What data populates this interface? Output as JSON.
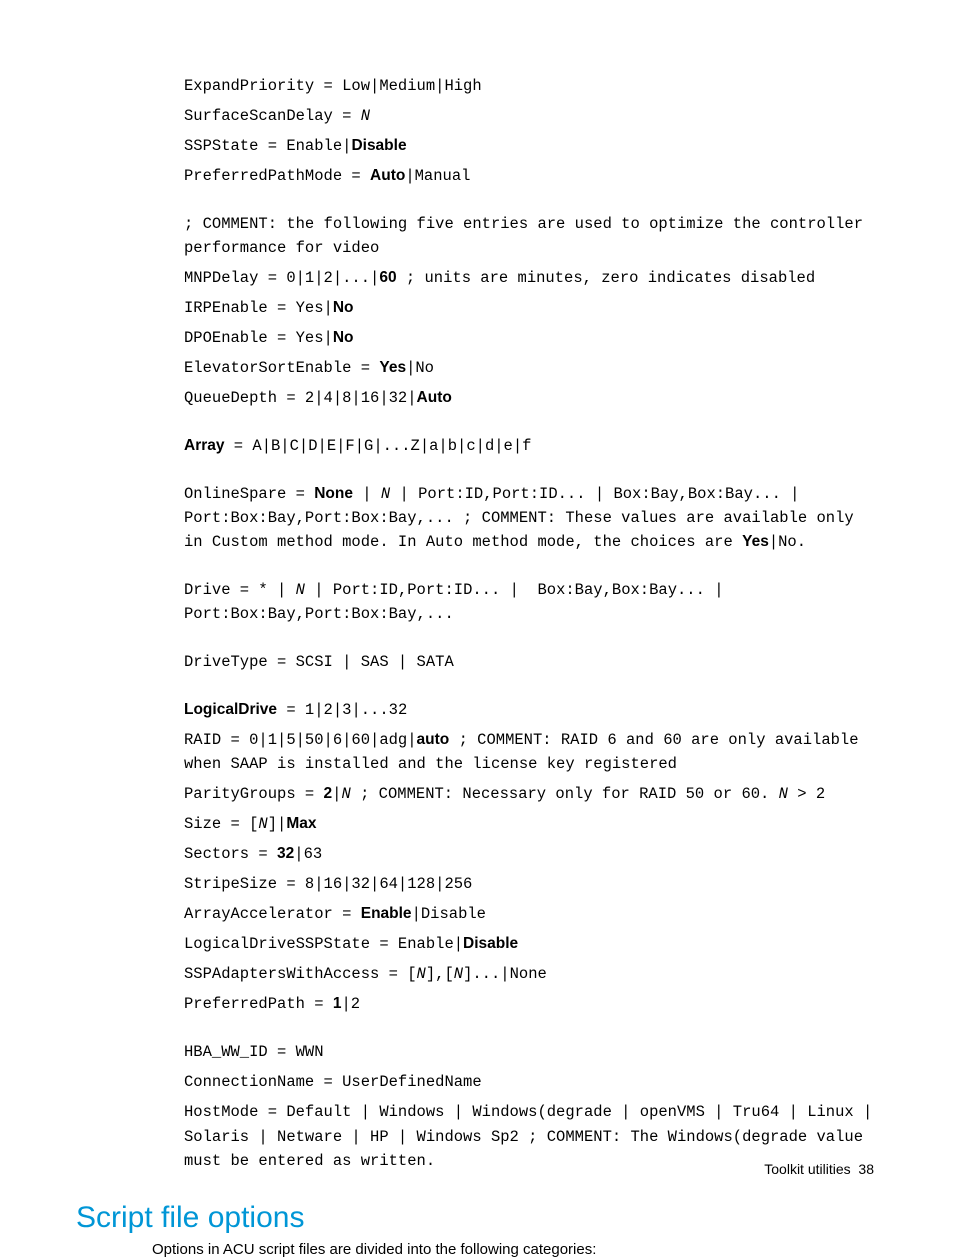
{
  "lines": {
    "l1": "ExpandPriority = Low|Medium|High",
    "l2a": "SurfaceScanDelay = ",
    "l2b": "N",
    "l3a": "SSPState = Enable|",
    "l3b": "Disable",
    "l4a": "PreferredPathMode = ",
    "l4b": "Auto",
    "l4c": "|Manual",
    "l5": "; COMMENT: the following five entries are used to optimize the controller performance for video",
    "l6a": "MNPDelay = 0|1|2|...|",
    "l6b": "60",
    "l6c": " ; units are minutes, zero indicates disabled",
    "l7a": "IRPEnable = Yes|",
    "l7b": "No",
    "l8a": "DPOEnable = Yes|",
    "l8b": "No",
    "l9a": "ElevatorSortEnable = ",
    "l9b": "Yes",
    "l9c": "|No",
    "l10a": "QueueDepth = 2|4|8|16|32|",
    "l10b": "Auto",
    "l11a": "Array",
    "l11b": " = A|B|C|D|E|F|G|...Z|a|b|c|d|e|f",
    "l12a": "OnlineSpare = ",
    "l12b": "None",
    "l12c": " | ",
    "l12d": "N",
    "l12e": " | Port:ID,Port:ID... | Box:Bay,Box:Bay... | Port:Box:Bay,Port:Box:Bay,... ; COMMENT: These values are available only in Custom method mode. In Auto method mode, the choices are ",
    "l12f": "Yes",
    "l12g": "|No.",
    "l13a": "Drive = * | ",
    "l13b": "N",
    "l13c": " | Port:ID,Port:ID... |  Box:Bay,Box:Bay... | Port:Box:Bay,Port:Box:Bay,...",
    "l14": "DriveType = SCSI | SAS | SATA",
    "l15a": "LogicalDrive",
    "l15b": " = 1|2|3|...32",
    "l16a": "RAID = 0|1|5|50|6|60|adg|",
    "l16b": "auto",
    "l16c": " ; COMMENT: RAID 6 and 60 are only available when SAAP is installed and the license key registered",
    "l17a": "ParityGroups = ",
    "l17b": "2",
    "l17c": "|",
    "l17d": "N",
    "l17e": " ; COMMENT: Necessary only for RAID 50 or 60. ",
    "l17f": "N",
    "l17g": " > 2",
    "l18a": "Size = [",
    "l18b": "N",
    "l18c": "]|",
    "l18d": "Max",
    "l19a": "Sectors = ",
    "l19b": "32",
    "l19c": "|63",
    "l20": "StripeSize = 8|16|32|64|128|256",
    "l21a": "ArrayAccelerator = ",
    "l21b": "Enable",
    "l21c": "|Disable",
    "l22a": "LogicalDriveSSPState = Enable|",
    "l22b": "Disable",
    "l23a": "SSPAdaptersWithAccess = [",
    "l23b": "N",
    "l23c": "],[",
    "l23d": "N",
    "l23e": "]...|None",
    "l24a": "PreferredPath = ",
    "l24b": "1",
    "l24c": "|2",
    "l25": "HBA_WW_ID = WWN",
    "l26": "ConnectionName = UserDefinedName",
    "l27": "HostMode = Default | Windows | Windows(degrade | openVMS | Tru64 | Linux | Solaris | Netware | HP | Windows Sp2 ; COMMENT: The Windows(degrade value must be entered as written."
  },
  "heading": "Script file options",
  "body": "Options in ACU script files are divided into the following categories:",
  "footer_label": "Toolkit utilities",
  "footer_page": "38"
}
